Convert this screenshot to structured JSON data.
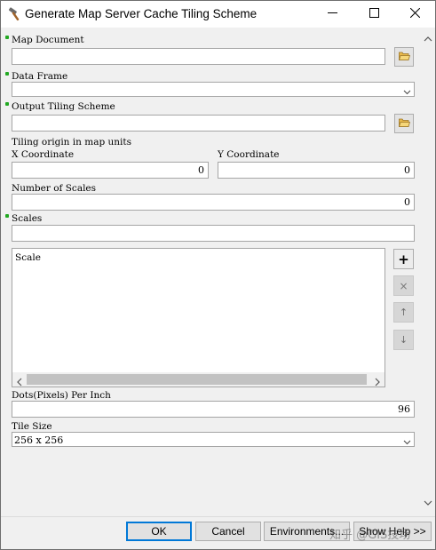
{
  "window": {
    "title": "Generate Map Server Cache Tiling Scheme",
    "icon": "hammer-icon",
    "controls": {
      "minimize": "minimize-icon",
      "maximize": "maximize-icon",
      "close": "close-icon"
    }
  },
  "form": {
    "map_document": {
      "label": "Map Document",
      "value": "",
      "required": true,
      "button_icon": "folder-open-icon"
    },
    "data_frame": {
      "label": "Data Frame",
      "value": "",
      "required": true
    },
    "output_tiling_scheme": {
      "label": "Output Tiling Scheme",
      "value": "",
      "required": true,
      "button_icon": "folder-open-icon"
    },
    "tiling_origin": {
      "label": "Tiling origin in map units",
      "x_label": "X Coordinate",
      "x_value": "0",
      "y_label": "Y Coordinate",
      "y_value": "0"
    },
    "number_of_scales": {
      "label": "Number of Scales",
      "value": "0"
    },
    "scales": {
      "label": "Scales",
      "required": true,
      "value": "",
      "table_header": "Scale",
      "rows": [],
      "buttons": {
        "add": "+",
        "remove": "×",
        "up": "↑",
        "down": "↓"
      }
    },
    "dpi": {
      "label": "Dots(Pixels) Per Inch",
      "value": "96"
    },
    "tile_size": {
      "label": "Tile Size",
      "value": "256 x 256"
    }
  },
  "footer": {
    "ok": "OK",
    "cancel": "Cancel",
    "environments": "Environments...",
    "show_help": "Show Help >>"
  },
  "watermark": "知乎 @GIS技场",
  "colors": {
    "required_marker": "#22a822",
    "default_button_border": "#0078d7"
  }
}
